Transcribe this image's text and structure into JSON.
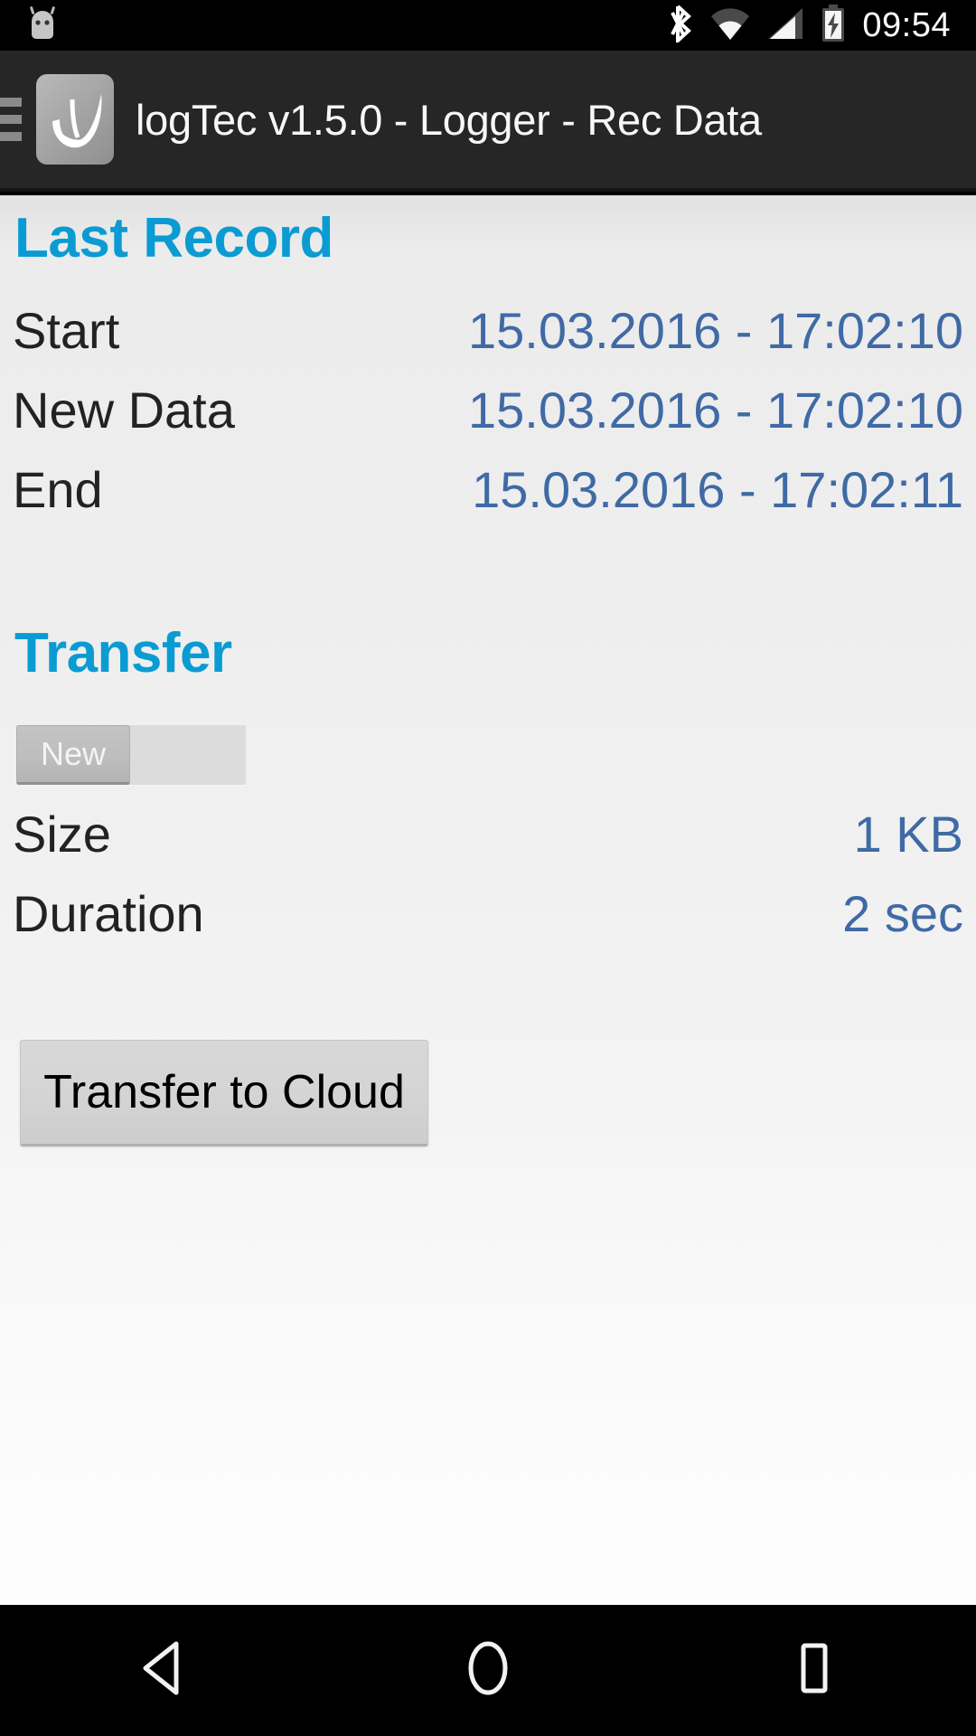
{
  "status_bar": {
    "notification_icon": "android-robot-icon",
    "icons": [
      "bluetooth-icon",
      "wifi-icon",
      "cellular-signal-icon",
      "battery-charging-icon"
    ],
    "clock": "09:54"
  },
  "action_bar": {
    "menu_icon": "hamburger-menu-icon",
    "app_icon": "logtec-app-icon",
    "title": "logTec v1.5.0 - Logger - Rec Data",
    "background_color": "#262626"
  },
  "theme": {
    "heading_color": "#0b9bd3",
    "value_color": "#3f6aa5",
    "label_color": "#222222",
    "content_background": "#eeeeee"
  },
  "sections": {
    "last_record": {
      "title": "Last Record",
      "rows": [
        {
          "label": "Start",
          "value": "15.03.2016 - 17:02:10"
        },
        {
          "label": "New Data",
          "value": "15.03.2016 - 17:02:10"
        },
        {
          "label": "End",
          "value": "15.03.2016 - 17:02:11"
        }
      ]
    },
    "transfer": {
      "title": "Transfer",
      "toggle": {
        "selected": "New",
        "options": [
          "New"
        ]
      },
      "rows": [
        {
          "label": "Size",
          "value": "1 KB"
        },
        {
          "label": "Duration",
          "value": "2 sec"
        }
      ],
      "action_button": "Transfer to Cloud"
    }
  },
  "nav_bar": {
    "back_icon": "back-triangle-icon",
    "home_icon": "home-circle-icon",
    "recents_icon": "recents-square-icon"
  }
}
